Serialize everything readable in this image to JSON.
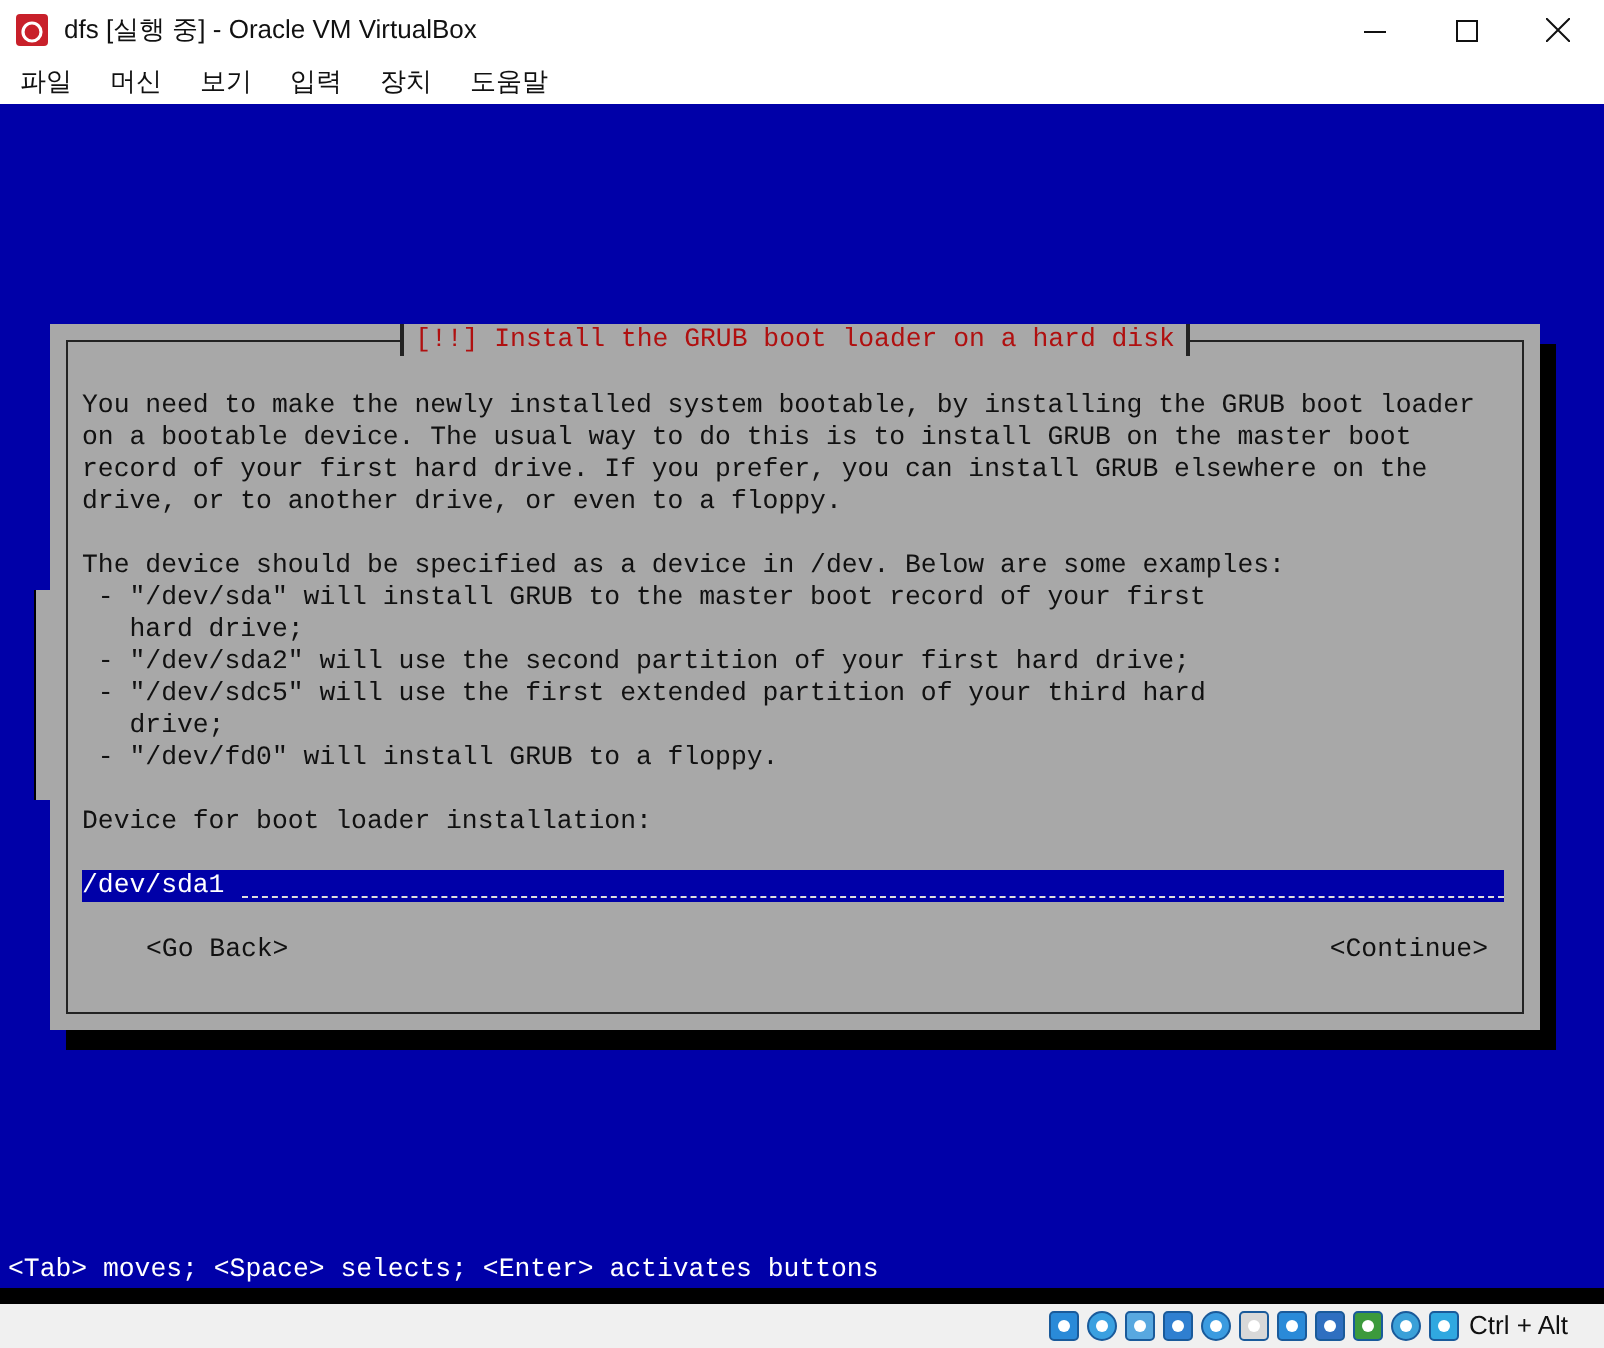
{
  "window": {
    "title": "dfs [실행 중] - Oracle VM VirtualBox"
  },
  "menu": [
    "파일",
    "머신",
    "보기",
    "입력",
    "장치",
    "도움말"
  ],
  "dialog": {
    "title": "[!!] Install the GRUB boot loader on a hard disk",
    "paragraphs": [
      [
        "You need to make the newly installed system bootable, by installing the GRUB boot loader",
        "on a bootable device. The usual way to do this is to install GRUB on the master boot",
        "record of your first hard drive. If you prefer, you can install GRUB elsewhere on the",
        "drive, or to another drive, or even to a floppy."
      ],
      [
        "The device should be specified as a device in /dev. Below are some examples:",
        " - \"/dev/sda\" will install GRUB to the master boot record of your first",
        "   hard drive;",
        " - \"/dev/sda2\" will use the second partition of your first hard drive;",
        " - \"/dev/sdc5\" will use the first extended partition of your third hard",
        "   drive;",
        " - \"/dev/fd0\" will install GRUB to a floppy."
      ],
      [
        "Device for boot loader installation:"
      ]
    ],
    "field": {
      "value": "/dev/sda1"
    },
    "buttons": [
      "<Go Back>",
      "<Continue>"
    ]
  },
  "hint": "<Tab> moves; <Space> selects; <Enter> activates buttons",
  "status_bar": {
    "host_key": "Ctrl + Alt"
  }
}
